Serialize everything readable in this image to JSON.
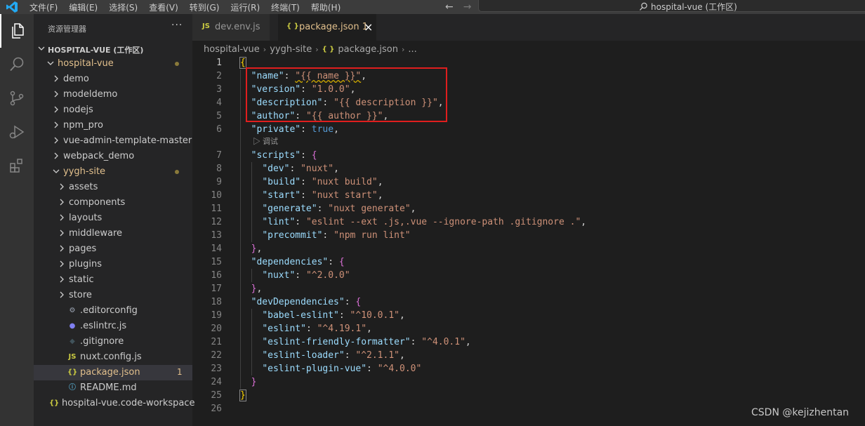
{
  "menu": [
    "文件(F)",
    "编辑(E)",
    "选择(S)",
    "查看(V)",
    "转到(G)",
    "运行(R)",
    "终端(T)",
    "帮助(H)"
  ],
  "nav": {
    "back": "←",
    "forward": "→"
  },
  "title_search": "hospital-vue (工作区)",
  "sidebar": {
    "title": "资源管理器",
    "more": "···",
    "workspace": "HOSPITAL-VUE (工作区)",
    "tree": [
      {
        "label": "hospital-vue",
        "depth": 0,
        "type": "folder-open",
        "modified": true
      },
      {
        "label": "demo",
        "depth": 1,
        "type": "folder"
      },
      {
        "label": "modeldemo",
        "depth": 1,
        "type": "folder"
      },
      {
        "label": "nodejs",
        "depth": 1,
        "type": "folder"
      },
      {
        "label": "npm_pro",
        "depth": 1,
        "type": "folder"
      },
      {
        "label": "vue-admin-template-master",
        "depth": 1,
        "type": "folder"
      },
      {
        "label": "webpack_demo",
        "depth": 1,
        "type": "folder"
      },
      {
        "label": "yygh-site",
        "depth": 1,
        "type": "folder-open",
        "modified": true
      },
      {
        "label": "assets",
        "depth": 2,
        "type": "folder"
      },
      {
        "label": "components",
        "depth": 2,
        "type": "folder"
      },
      {
        "label": "layouts",
        "depth": 2,
        "type": "folder"
      },
      {
        "label": "middleware",
        "depth": 2,
        "type": "folder"
      },
      {
        "label": "pages",
        "depth": 2,
        "type": "folder"
      },
      {
        "label": "plugins",
        "depth": 2,
        "type": "folder"
      },
      {
        "label": "static",
        "depth": 2,
        "type": "folder"
      },
      {
        "label": "store",
        "depth": 2,
        "type": "folder"
      },
      {
        "label": ".editorconfig",
        "depth": 2,
        "type": "gear"
      },
      {
        "label": ".eslintrc.js",
        "depth": 2,
        "type": "eslint"
      },
      {
        "label": ".gitignore",
        "depth": 2,
        "type": "git"
      },
      {
        "label": "nuxt.config.js",
        "depth": 2,
        "type": "js"
      },
      {
        "label": "package.json",
        "depth": 2,
        "type": "json",
        "selected": true,
        "badge": "1"
      },
      {
        "label": "README.md",
        "depth": 2,
        "type": "info"
      },
      {
        "label": "hospital-vue.code-workspace",
        "depth": 0,
        "type": "json-ws"
      }
    ]
  },
  "tabs": [
    {
      "label": "dev.env.js",
      "icon": "JS"
    },
    {
      "label": "package.json 1",
      "icon": "{ }",
      "close": "×"
    }
  ],
  "breadcrumb": [
    "hospital-vue",
    "yygh-site",
    "package.json",
    "..."
  ],
  "breadcrumb_json_icon": "{ }",
  "codelens_label": "▷ 调试",
  "code": [
    [
      [
        "br1",
        "{"
      ]
    ],
    [
      [
        "t",
        "  "
      ],
      [
        "k",
        "\"name\""
      ],
      [
        "t",
        ": "
      ],
      [
        "sq",
        "\"{{ name }}\""
      ],
      [
        "t",
        ","
      ]
    ],
    [
      [
        "t",
        "  "
      ],
      [
        "k",
        "\"version\""
      ],
      [
        "t",
        ": "
      ],
      [
        "s",
        "\"1.0.0\""
      ],
      [
        "t",
        ","
      ]
    ],
    [
      [
        "t",
        "  "
      ],
      [
        "k",
        "\"description\""
      ],
      [
        "t",
        ": "
      ],
      [
        "s",
        "\"{{ description }}\""
      ],
      [
        "t",
        ","
      ]
    ],
    [
      [
        "t",
        "  "
      ],
      [
        "k",
        "\"author\""
      ],
      [
        "t",
        ": "
      ],
      [
        "s",
        "\"{{ author }}\""
      ],
      [
        "t",
        ","
      ]
    ],
    [
      [
        "t",
        "  "
      ],
      [
        "k",
        "\"private\""
      ],
      [
        "t",
        ": "
      ],
      [
        "b",
        "true"
      ],
      [
        "t",
        ","
      ]
    ],
    [
      [
        "t",
        "  "
      ],
      [
        "k",
        "\"scripts\""
      ],
      [
        "t",
        ": "
      ],
      [
        "br2",
        "{"
      ]
    ],
    [
      [
        "t",
        "    "
      ],
      [
        "k",
        "\"dev\""
      ],
      [
        "t",
        ": "
      ],
      [
        "s",
        "\"nuxt\""
      ],
      [
        "t",
        ","
      ]
    ],
    [
      [
        "t",
        "    "
      ],
      [
        "k",
        "\"build\""
      ],
      [
        "t",
        ": "
      ],
      [
        "s",
        "\"nuxt build\""
      ],
      [
        "t",
        ","
      ]
    ],
    [
      [
        "t",
        "    "
      ],
      [
        "k",
        "\"start\""
      ],
      [
        "t",
        ": "
      ],
      [
        "s",
        "\"nuxt start\""
      ],
      [
        "t",
        ","
      ]
    ],
    [
      [
        "t",
        "    "
      ],
      [
        "k",
        "\"generate\""
      ],
      [
        "t",
        ": "
      ],
      [
        "s",
        "\"nuxt generate\""
      ],
      [
        "t",
        ","
      ]
    ],
    [
      [
        "t",
        "    "
      ],
      [
        "k",
        "\"lint\""
      ],
      [
        "t",
        ": "
      ],
      [
        "s",
        "\"eslint --ext .js,.vue --ignore-path .gitignore .\""
      ],
      [
        "t",
        ","
      ]
    ],
    [
      [
        "t",
        "    "
      ],
      [
        "k",
        "\"precommit\""
      ],
      [
        "t",
        ": "
      ],
      [
        "s",
        "\"npm run lint\""
      ]
    ],
    [
      [
        "t",
        "  "
      ],
      [
        "br2",
        "}"
      ],
      [
        "t",
        ","
      ]
    ],
    [
      [
        "t",
        "  "
      ],
      [
        "k",
        "\"dependencies\""
      ],
      [
        "t",
        ": "
      ],
      [
        "br2",
        "{"
      ]
    ],
    [
      [
        "t",
        "    "
      ],
      [
        "k",
        "\"nuxt\""
      ],
      [
        "t",
        ": "
      ],
      [
        "s",
        "\"^2.0.0\""
      ]
    ],
    [
      [
        "t",
        "  "
      ],
      [
        "br2",
        "}"
      ],
      [
        "t",
        ","
      ]
    ],
    [
      [
        "t",
        "  "
      ],
      [
        "k",
        "\"devDependencies\""
      ],
      [
        "t",
        ": "
      ],
      [
        "br2",
        "{"
      ]
    ],
    [
      [
        "t",
        "    "
      ],
      [
        "k",
        "\"babel-eslint\""
      ],
      [
        "t",
        ": "
      ],
      [
        "s",
        "\"^10.0.1\""
      ],
      [
        "t",
        ","
      ]
    ],
    [
      [
        "t",
        "    "
      ],
      [
        "k",
        "\"eslint\""
      ],
      [
        "t",
        ": "
      ],
      [
        "s",
        "\"^4.19.1\""
      ],
      [
        "t",
        ","
      ]
    ],
    [
      [
        "t",
        "    "
      ],
      [
        "k",
        "\"eslint-friendly-formatter\""
      ],
      [
        "t",
        ": "
      ],
      [
        "s",
        "\"^4.0.1\""
      ],
      [
        "t",
        ","
      ]
    ],
    [
      [
        "t",
        "    "
      ],
      [
        "k",
        "\"eslint-loader\""
      ],
      [
        "t",
        ": "
      ],
      [
        "s",
        "\"^2.1.1\""
      ],
      [
        "t",
        ","
      ]
    ],
    [
      [
        "t",
        "    "
      ],
      [
        "k",
        "\"eslint-plugin-vue\""
      ],
      [
        "t",
        ": "
      ],
      [
        "s",
        "\"^4.0.0\""
      ]
    ],
    [
      [
        "t",
        "  "
      ],
      [
        "br2",
        "}"
      ]
    ],
    [
      [
        "br1",
        "}"
      ]
    ],
    []
  ],
  "watermark": "CSDN @kejizhentan",
  "colors": {
    "highlight": "#e01e1e",
    "accent": "#007acc"
  }
}
